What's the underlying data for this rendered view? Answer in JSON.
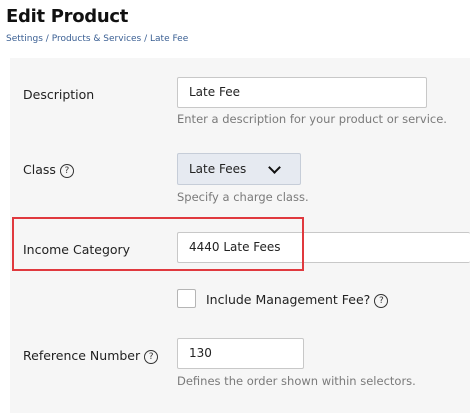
{
  "header": {
    "title": "Edit Product",
    "breadcrumb": [
      "Settings",
      "Products & Services",
      "Late Fee"
    ],
    "separator": " / "
  },
  "form": {
    "description": {
      "label": "Description",
      "value": "Late Fee",
      "hint": "Enter a description for your product or service."
    },
    "class": {
      "label": "Class",
      "help": "?",
      "value": "Late Fees",
      "hint": "Specify a charge class."
    },
    "income_category": {
      "label": "Income Category",
      "value": "4440 Late Fees"
    },
    "management_fee": {
      "label": "Include Management Fee?",
      "help": "?",
      "checked": false
    },
    "reference_number": {
      "label": "Reference Number",
      "help": "?",
      "value": "130",
      "hint": "Defines the order shown within selectors."
    }
  },
  "colors": {
    "highlight": "#e0393e",
    "breadcrumb": "#3a5f93",
    "panel": "#f6f6f6"
  },
  "icons": [
    "help-icon",
    "chevron-down-icon"
  ]
}
